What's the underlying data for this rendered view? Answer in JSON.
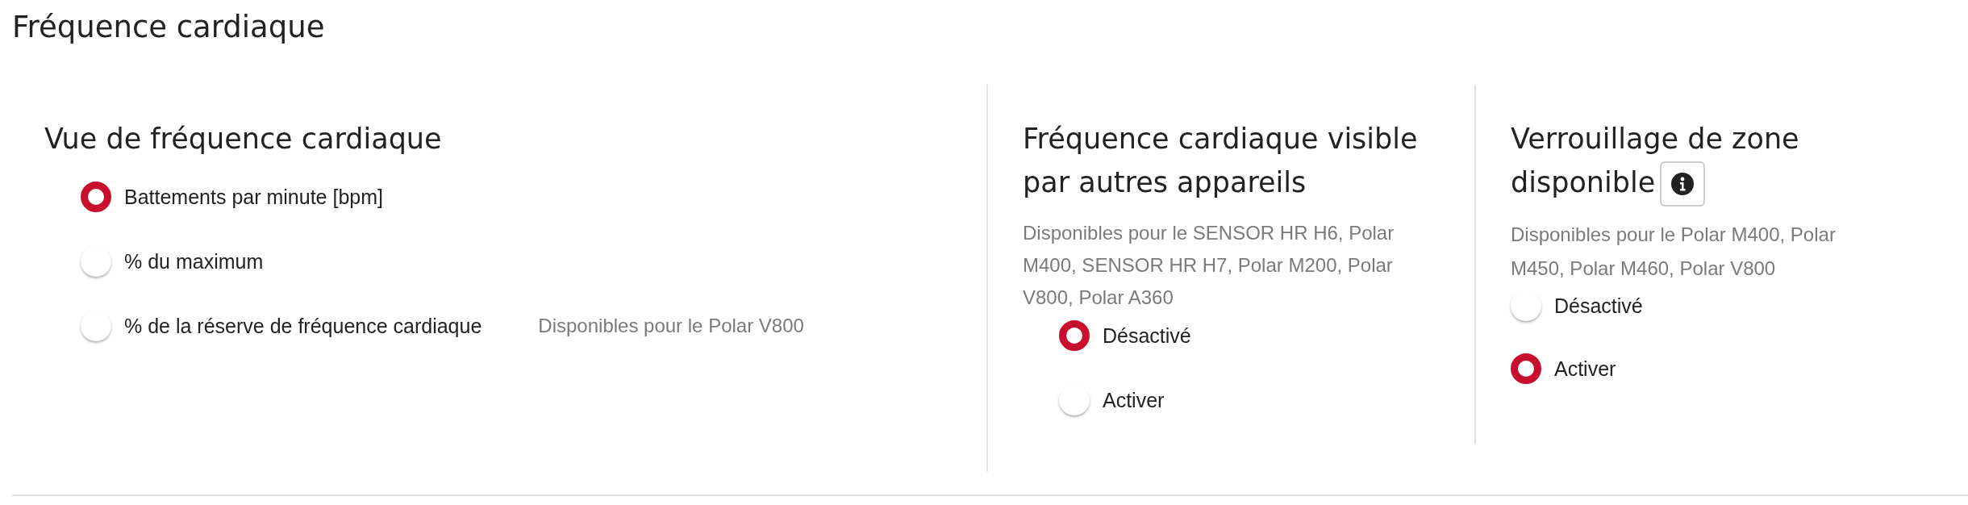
{
  "title": "Fréquence cardiaque",
  "sections": [
    {
      "heading": "Vue de fréquence cardiaque",
      "options": [
        {
          "label": "Battements par minute [bpm]",
          "selected": true
        },
        {
          "label": "% du maximum",
          "selected": false
        },
        {
          "label": "% de la réserve de fréquence cardiaque",
          "selected": false,
          "note": "Disponibles pour le Polar V800"
        }
      ]
    },
    {
      "heading": "Fréquence cardiaque visible par autres appareils",
      "note": "Disponibles pour le SENSOR HR H6, Polar M400, SENSOR HR H7, Polar M200, Polar V800, Polar A360",
      "options": [
        {
          "label": "Désactivé",
          "selected": true
        },
        {
          "label": "Activer",
          "selected": false
        }
      ]
    },
    {
      "heading": "Verrouillage de zone disponible",
      "info": true,
      "note": "Disponibles pour le Polar M400, Polar M450, Polar M460, Polar V800",
      "options": [
        {
          "label": "Désactivé",
          "selected": false
        },
        {
          "label": "Activer",
          "selected": true
        }
      ]
    }
  ]
}
